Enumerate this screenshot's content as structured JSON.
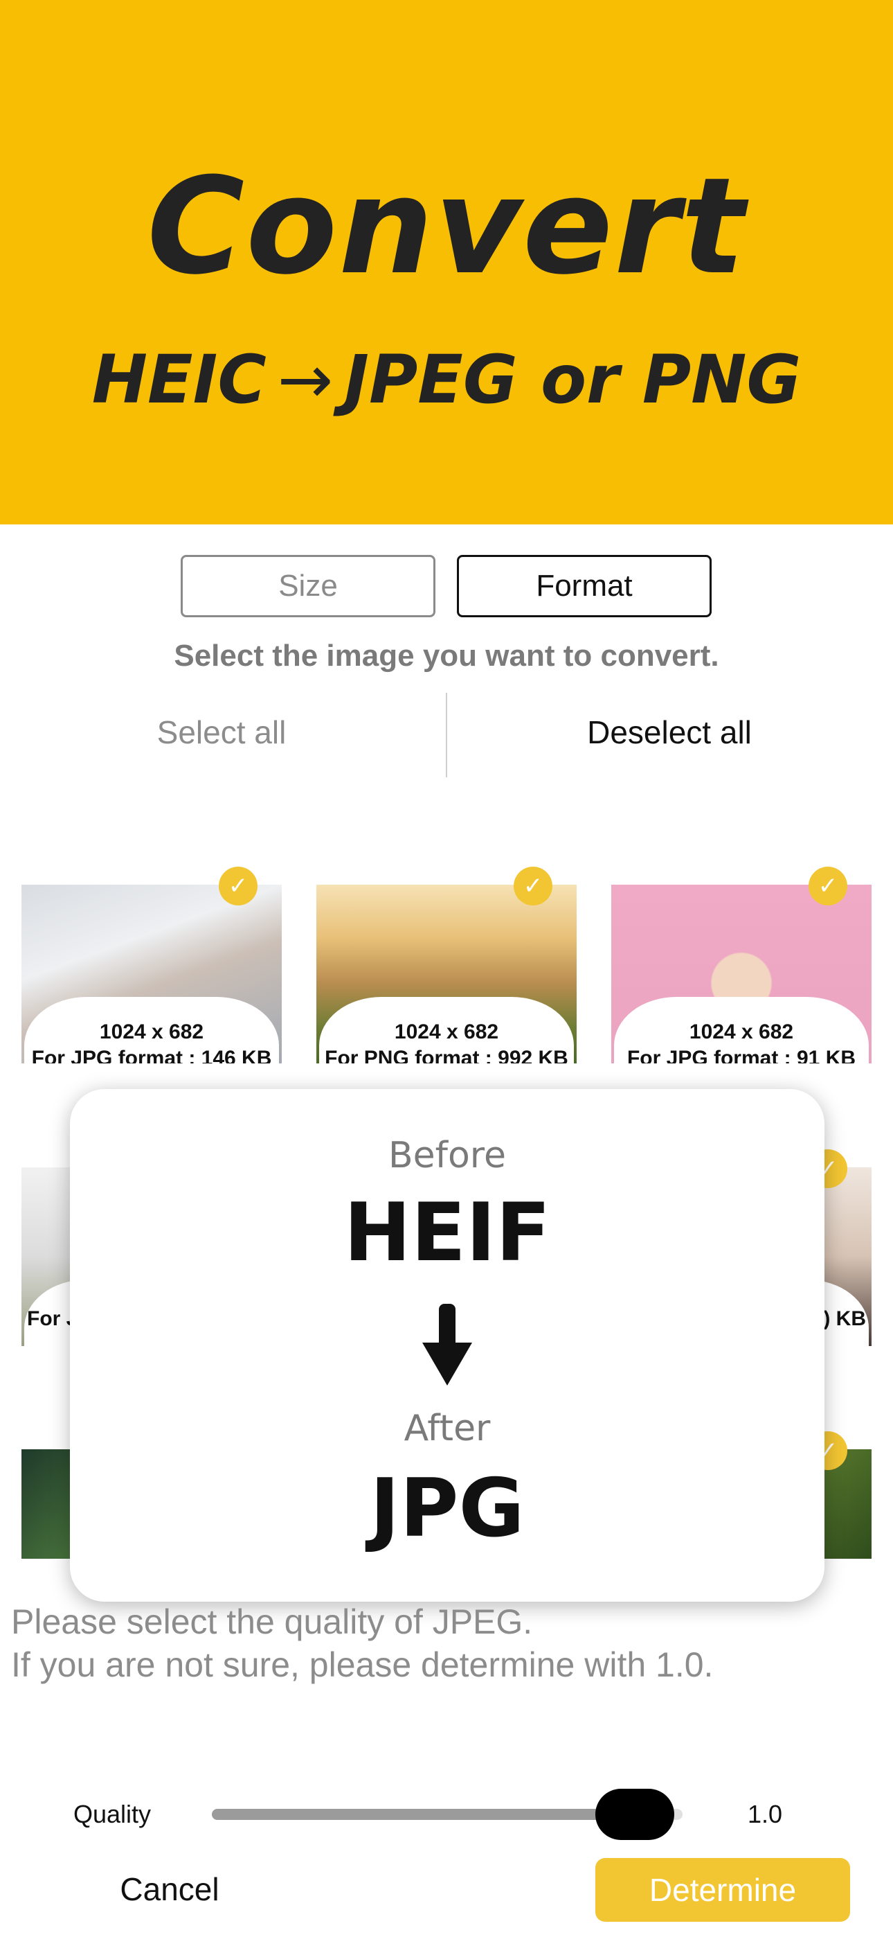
{
  "hero": {
    "title": "Convert",
    "subtitle_from": "HEIC",
    "subtitle_arrow": "→",
    "subtitle_to": "JPEG or PNG",
    "background_color": "#F8BE04"
  },
  "tabs": [
    {
      "label": "Size",
      "selected": false
    },
    {
      "label": "Format",
      "selected": true
    }
  ],
  "instruction": "Select the image you want to convert.",
  "selection": {
    "select_all": "Select all",
    "deselect_all": "Deselect all"
  },
  "thumbnails": [
    {
      "dims": "1024 x 682",
      "info": "For JPG format : 146 KB",
      "checked": true
    },
    {
      "dims": "1024 x 682",
      "info": "For PNG format : 992 KB",
      "checked": true
    },
    {
      "dims": "1024 x 682",
      "info": "For JPG format : 91 KB",
      "checked": true
    },
    {
      "info_partial_left": "For J",
      "checked": false
    },
    {
      "info_partial_right": ") KB",
      "checked": true
    },
    {
      "checked": false
    },
    {
      "checked": true
    }
  ],
  "conversion_card": {
    "before_label": "Before",
    "before_format": "HEIF",
    "arrow_icon": "down-arrow-icon",
    "after_label": "After",
    "after_format": "JPG"
  },
  "quality_note": {
    "line1": "Please select the quality of JPEG.",
    "line2": "If you are not sure, please determine with 1.0."
  },
  "quality": {
    "label": "Quality",
    "value_text": "1.0",
    "value": 1.0
  },
  "buttons": {
    "cancel": "Cancel",
    "determine": "Determine"
  },
  "colors": {
    "accent": "#F2C533",
    "check": "#F2C533"
  }
}
